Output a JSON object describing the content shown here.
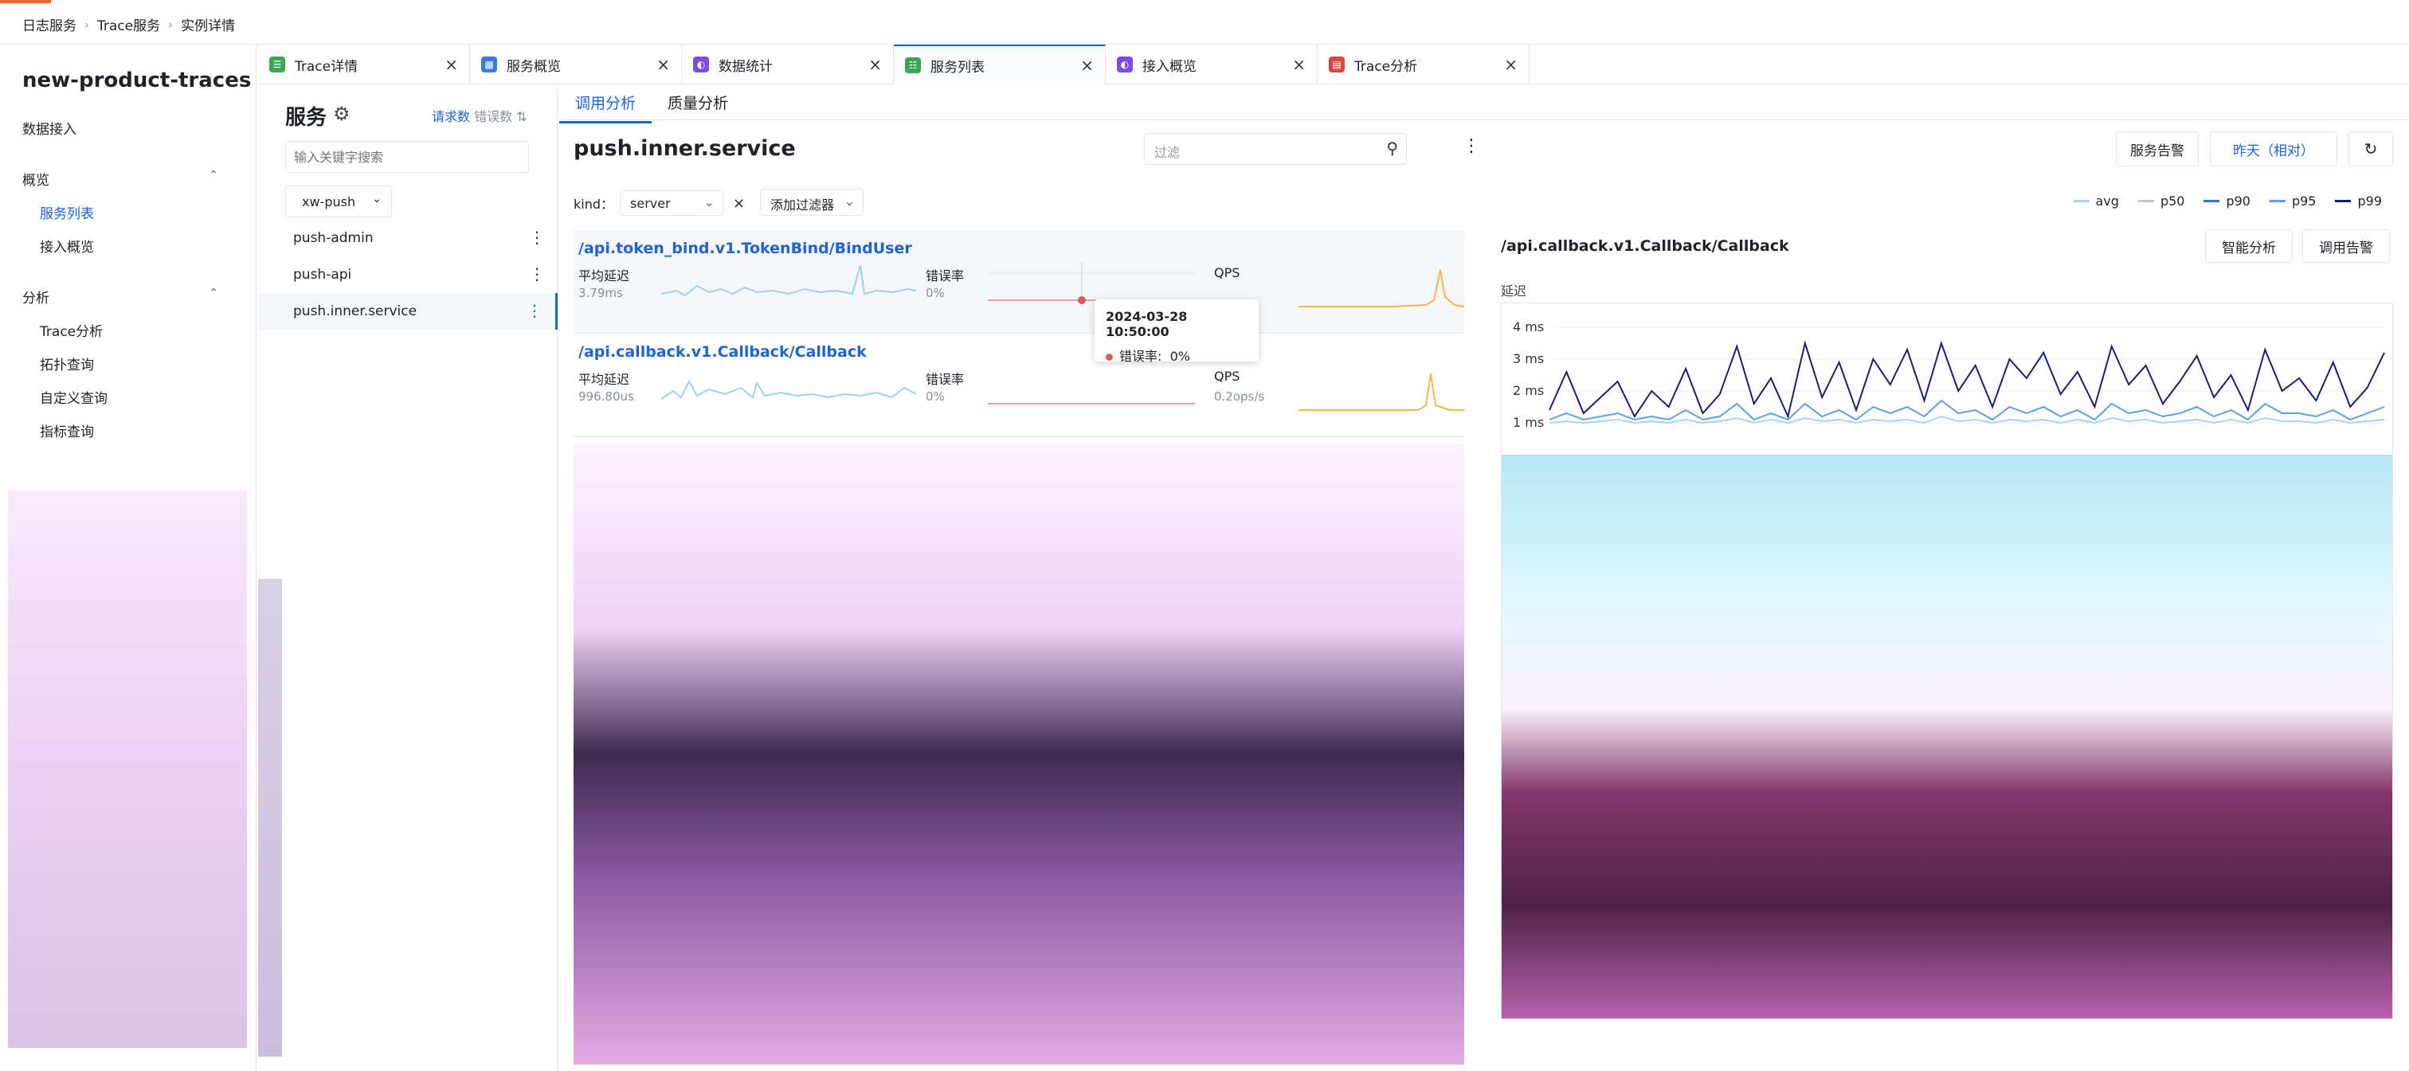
{
  "breadcrumb": [
    "日志服务",
    "Trace服务",
    "实例详情"
  ],
  "app_name": "new-product-traces",
  "nav": {
    "data_ingest": "数据接入",
    "overview_group": "概览",
    "service_list": "服务列表",
    "ingest_overview": "接入概览",
    "analysis_group": "分析",
    "trace_analysis": "Trace分析",
    "topology": "拓扑查询",
    "custom_query": "自定义查询",
    "metric_query": "指标查询"
  },
  "tabs": [
    {
      "label": "Trace详情",
      "icon": "trace-detail-icon",
      "color": "#3aa655"
    },
    {
      "label": "服务概览",
      "icon": "service-overview-icon",
      "color": "#3b7be0"
    },
    {
      "label": "数据统计",
      "icon": "data-stats-icon",
      "color": "#7a4de8"
    },
    {
      "label": "服务列表",
      "icon": "service-list-icon",
      "color": "#3aa655"
    },
    {
      "label": "接入概览",
      "icon": "ingest-overview-icon",
      "color": "#7a4de8"
    },
    {
      "label": "Trace分析",
      "icon": "trace-analysis-icon",
      "color": "#d9453f"
    }
  ],
  "service_panel": {
    "title": "服务",
    "sort_requests": "请求数",
    "sort_errors": "错误数",
    "search_placeholder": "输入关键字搜索",
    "project": "xw-push",
    "services": [
      "push-admin",
      "push-api",
      "push.inner.service"
    ]
  },
  "subtabs": [
    "调用分析",
    "质量分析"
  ],
  "service_title": "push.inner.service",
  "filter_placeholder": "过滤",
  "buttons": {
    "alert": "服务告警",
    "time_range": "昨天（相对）",
    "smart_analysis": "智能分析",
    "call_alert": "调用告警"
  },
  "kind_filter": {
    "label": "kind：",
    "value": "server",
    "add_filter": "添加过滤器"
  },
  "legend": [
    {
      "name": "avg",
      "color": "#a9d2f5"
    },
    {
      "name": "p50",
      "color": "#b9c7dc"
    },
    {
      "name": "p90",
      "color": "#3b6fd6"
    },
    {
      "name": "p95",
      "color": "#5aa0e8"
    },
    {
      "name": "p99",
      "color": "#1a1f6e"
    }
  ],
  "endpoints": [
    {
      "name": "/api.token_bind.v1.TokenBind/BindUser",
      "avg_latency_label": "平均延迟",
      "avg_latency": "3.79ms",
      "error_label": "错误率",
      "error_rate": "0%",
      "qps_label": "QPS",
      "qps": ""
    },
    {
      "name": "/api.callback.v1.Callback/Callback",
      "avg_latency_label": "平均延迟",
      "avg_latency": "996.80us",
      "error_label": "错误率",
      "error_rate": "0%",
      "qps_label": "QPS",
      "qps": "0.2ops/s"
    }
  ],
  "tooltip": {
    "time": "2024-03-28 10:50:00",
    "label": "错误率:",
    "value": "0%"
  },
  "detail": {
    "endpoint": "/api.callback.v1.Callback/Callback",
    "y_label": "延迟",
    "y_ticks": [
      "4 ms",
      "3 ms",
      "2 ms",
      "1 ms"
    ]
  },
  "chart_data": {
    "type": "line",
    "ylabel": "延迟",
    "ylim": [
      0,
      4.5
    ],
    "y_ticks": [
      "1 ms",
      "2 ms",
      "3 ms",
      "4 ms"
    ],
    "legend_position": "top-right",
    "series": [
      {
        "name": "p99",
        "values": [
          1.4,
          2.6,
          1.3,
          1.8,
          2.3,
          1.2,
          2.0,
          1.5,
          2.7,
          1.3,
          1.9,
          3.4,
          1.6,
          2.4,
          1.2,
          3.5,
          1.8,
          2.9,
          1.4,
          3.0,
          2.2,
          3.3,
          1.7,
          3.5,
          2.0,
          2.8,
          1.5,
          3.0,
          2.4,
          3.2,
          1.9,
          2.6,
          1.5,
          3.4,
          2.2,
          2.8,
          1.6,
          2.3,
          3.1,
          1.8,
          2.5,
          1.4,
          3.3,
          2.0,
          2.4,
          1.7,
          2.9,
          1.5,
          2.1,
          3.2
        ]
      },
      {
        "name": "p95",
        "values": [
          1.1,
          1.3,
          1.1,
          1.2,
          1.3,
          1.1,
          1.2,
          1.1,
          1.4,
          1.1,
          1.2,
          1.6,
          1.1,
          1.3,
          1.1,
          1.6,
          1.2,
          1.4,
          1.1,
          1.5,
          1.3,
          1.5,
          1.2,
          1.7,
          1.3,
          1.4,
          1.1,
          1.5,
          1.3,
          1.5,
          1.2,
          1.4,
          1.1,
          1.6,
          1.3,
          1.4,
          1.2,
          1.3,
          1.5,
          1.2,
          1.4,
          1.1,
          1.6,
          1.3,
          1.3,
          1.2,
          1.4,
          1.1,
          1.3,
          1.5
        ]
      },
      {
        "name": "avg",
        "values": [
          1.0,
          1.05,
          1.0,
          1.05,
          1.1,
          1.0,
          1.05,
          1.0,
          1.1,
          1.0,
          1.05,
          1.15,
          1.0,
          1.1,
          1.0,
          1.15,
          1.05,
          1.1,
          1.0,
          1.1,
          1.05,
          1.1,
          1.0,
          1.2,
          1.05,
          1.1,
          1.0,
          1.1,
          1.05,
          1.1,
          1.0,
          1.1,
          1.0,
          1.15,
          1.05,
          1.1,
          1.0,
          1.05,
          1.1,
          1.0,
          1.1,
          1.0,
          1.15,
          1.05,
          1.05,
          1.0,
          1.1,
          1.0,
          1.05,
          1.1
        ]
      }
    ]
  }
}
